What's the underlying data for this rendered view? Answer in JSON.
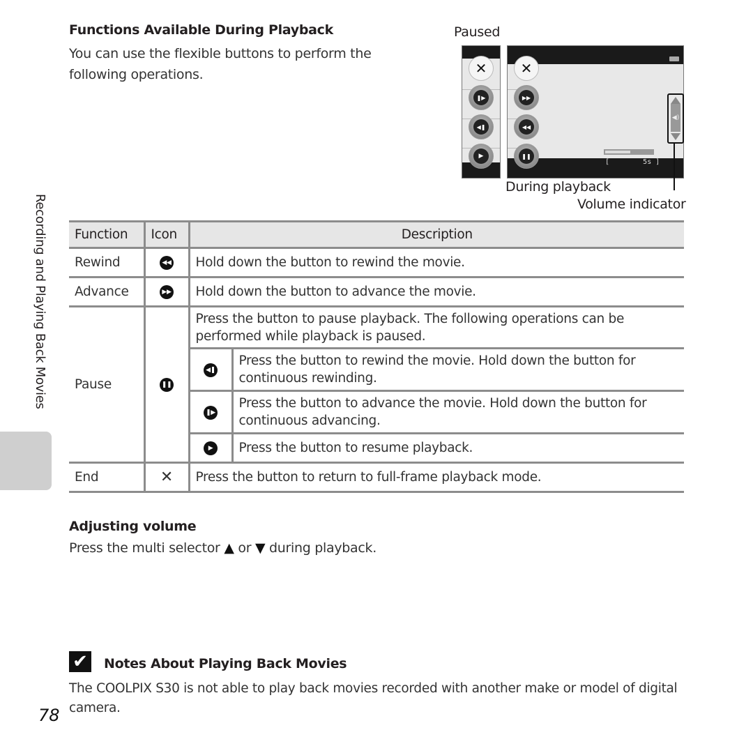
{
  "header": {
    "title": "Functions Available During Playback",
    "intro": "You can use the flexible buttons to perform the following operations."
  },
  "figure": {
    "paused_label": "Paused",
    "during_label": "During playback",
    "volume_label": "Volume indicator",
    "time_display": "[        5s ]",
    "progress_fraction": 0.5,
    "paused_buttons": [
      "close-icon",
      "frame-advance-icon",
      "frame-rewind-icon",
      "play-icon"
    ],
    "playback_buttons": [
      "close-icon",
      "advance-icon",
      "rewind-icon",
      "pause-icon"
    ]
  },
  "side": {
    "label": "Recording and Playing Back Movies"
  },
  "table": {
    "headers": [
      "Function",
      "Icon",
      "Description"
    ],
    "rows": [
      {
        "function": "Rewind",
        "icon": "rewind-icon",
        "glyph": "◀◀",
        "description": "Hold down the button to rewind the movie."
      },
      {
        "function": "Advance",
        "icon": "advance-icon",
        "glyph": "▶▶",
        "description": "Hold down the button to advance the movie."
      },
      {
        "function": "Pause",
        "icon": "pause-icon",
        "glyph": "❚❚",
        "description": "Press the button to pause playback. The following operations can be performed while playback is paused.",
        "sub": [
          {
            "icon": "frame-rewind-icon",
            "glyph": "◀❚",
            "description": "Press the button to rewind the movie. Hold down the button for continuous rewinding."
          },
          {
            "icon": "frame-advance-icon",
            "glyph": "❚▶",
            "description": "Press the button to advance the movie. Hold down the button for continuous advancing."
          },
          {
            "icon": "play-icon",
            "glyph": "▶",
            "description": "Press the button to resume playback."
          }
        ]
      },
      {
        "function": "End",
        "icon": "close-icon",
        "glyph": "✕",
        "description": "Press the button to return to full-frame playback mode."
      }
    ]
  },
  "volume": {
    "heading": "Adjusting volume",
    "text_before": "Press the multi selector",
    "up": "▲",
    "or": "or",
    "down": "▼",
    "text_after": "during playback."
  },
  "notes": {
    "check": "✔",
    "heading": "Notes About Playing Back Movies",
    "text": "The COOLPIX S30 is not able to play back movies recorded with another make or model of digital camera."
  },
  "page_number": "78"
}
